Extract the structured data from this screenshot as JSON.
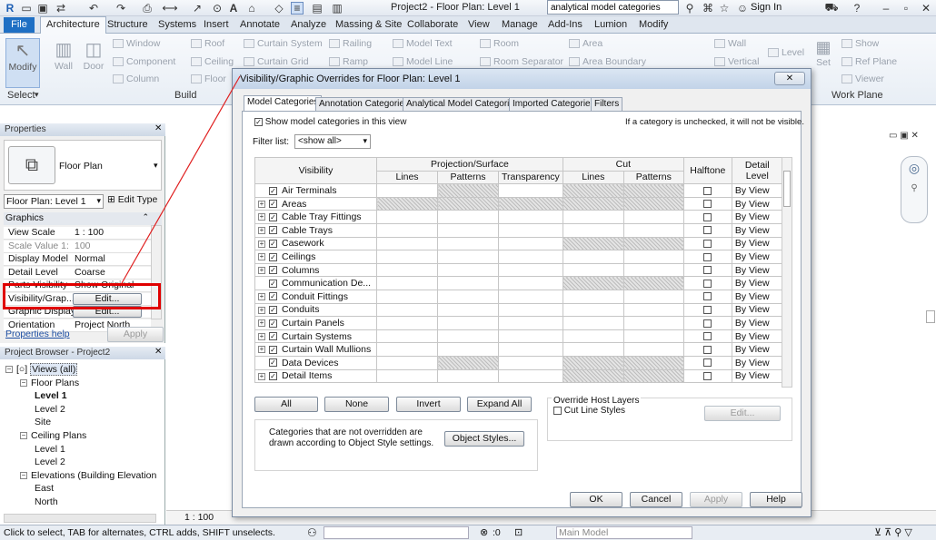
{
  "app": {
    "title": "Project2 - Floor Plan: Level 1",
    "search_value": "analytical model categories",
    "sign_in": "Sign In"
  },
  "ribbon_tabs": [
    "File",
    "Architecture",
    "Structure",
    "Systems",
    "Insert",
    "Annotate",
    "Analyze",
    "Massing & Site",
    "Collaborate",
    "View",
    "Manage",
    "Add-Ins",
    "Lumion",
    "Modify"
  ],
  "ribbon": {
    "modify": "Modify",
    "select": "Select",
    "wall": "Wall",
    "door": "Door",
    "window": "Window",
    "component": "Component",
    "column": "Column",
    "roof": "Roof",
    "ceiling": "Ceiling",
    "floor": "Floor",
    "curtain_system": "Curtain System",
    "curtain_grid": "Curtain Grid",
    "railing": "Railing",
    "ramp": "Ramp",
    "model_text": "Model Text",
    "model_line": "Model Line",
    "room": "Room",
    "room_separator": "Room Separator",
    "area": "Area",
    "area_boundary": "Area Boundary",
    "wall2": "Wall",
    "vertical": "Vertical",
    "level": "Level",
    "set": "Set",
    "show": "Show",
    "ref_plane": "Ref Plane",
    "viewer": "Viewer",
    "build": "Build",
    "work_plane": "Work Plane"
  },
  "properties": {
    "header": "Properties",
    "type_name": "Floor Plan",
    "selector": "Floor Plan: Level 1",
    "edit_type": "Edit Type",
    "section": "Graphics",
    "rows": [
      {
        "k": "View Scale",
        "v": "1 : 100"
      },
      {
        "k": "Scale Value   1:",
        "v": "100"
      },
      {
        "k": "Display Model",
        "v": "Normal"
      },
      {
        "k": "Detail Level",
        "v": "Coarse"
      },
      {
        "k": "Parts Visibility",
        "v": "Show Original"
      },
      {
        "k": "Visibility/Grap...",
        "v": "Edit..."
      },
      {
        "k": "Graphic Display...",
        "v": "Edit..."
      },
      {
        "k": "Orientation",
        "v": "Project North"
      }
    ],
    "help": "Properties help",
    "apply": "Apply"
  },
  "browser": {
    "header": "Project Browser - Project2",
    "items": [
      {
        "label": "Views (all)",
        "level": 0
      },
      {
        "label": "Floor Plans",
        "level": 1
      },
      {
        "label": "Level 1",
        "level": 2,
        "bold": true
      },
      {
        "label": "Level 2",
        "level": 2
      },
      {
        "label": "Site",
        "level": 2
      },
      {
        "label": "Ceiling Plans",
        "level": 1
      },
      {
        "label": "Level 1",
        "level": 2
      },
      {
        "label": "Level 2",
        "level": 2
      },
      {
        "label": "Elevations (Building Elevation",
        "level": 1
      },
      {
        "label": "East",
        "level": 2
      },
      {
        "label": "North",
        "level": 2
      }
    ]
  },
  "status": {
    "text": "Click to select, TAB for alternates, CTRL adds, SHIFT unselects.",
    "scale": "1 : 100",
    "zero": ":0",
    "model": "Main Model"
  },
  "dialog": {
    "title": "Visibility/Graphic Overrides for Floor Plan: Level 1",
    "tabs": [
      "Model Categories",
      "Annotation Categories",
      "Analytical Model Categories",
      "Imported Categories",
      "Filters"
    ],
    "show_label": "Show model categories in this view",
    "hint": "If a category is unchecked, it will not be visible.",
    "filter_label": "Filter list:",
    "filter_value": "<show all>",
    "headers": {
      "visibility": "Visibility",
      "proj": "Projection/Surface",
      "cut": "Cut",
      "lines": "Lines",
      "patterns": "Patterns",
      "transparency": "Transparency",
      "halftone": "Halftone",
      "detail": "Detail Level"
    },
    "rows": [
      {
        "name": "Air Terminals",
        "exp": false,
        "ps_pat": true,
        "cut": true
      },
      {
        "name": "Areas",
        "exp": true,
        "ps_line": true,
        "ps_pat": true,
        "cut": true
      },
      {
        "name": "Cable Tray Fittings",
        "exp": true
      },
      {
        "name": "Cable Trays",
        "exp": true
      },
      {
        "name": "Casework",
        "exp": true,
        "cut": true
      },
      {
        "name": "Ceilings",
        "exp": true
      },
      {
        "name": "Columns",
        "exp": true
      },
      {
        "name": "Communication De...",
        "exp": false,
        "cut": true
      },
      {
        "name": "Conduit Fittings",
        "exp": true
      },
      {
        "name": "Conduits",
        "exp": true
      },
      {
        "name": "Curtain Panels",
        "exp": true
      },
      {
        "name": "Curtain Systems",
        "exp": true
      },
      {
        "name": "Curtain Wall Mullions",
        "exp": true
      },
      {
        "name": "Data Devices",
        "exp": false,
        "ps_pat": true,
        "cut": true
      },
      {
        "name": "Detail Items",
        "exp": true,
        "cut": true
      }
    ],
    "detail_value": "By View",
    "buttons": {
      "all": "All",
      "none": "None",
      "invert": "Invert",
      "expand": "Expand All",
      "object_styles": "Object Styles...",
      "edit": "Edit...",
      "ok": "OK",
      "cancel": "Cancel",
      "apply": "Apply",
      "help": "Help"
    },
    "note": "Categories that are not overridden are drawn according to Object Style settings.",
    "override_title": "Override Host Layers",
    "cut_line_styles": "Cut Line Styles"
  }
}
